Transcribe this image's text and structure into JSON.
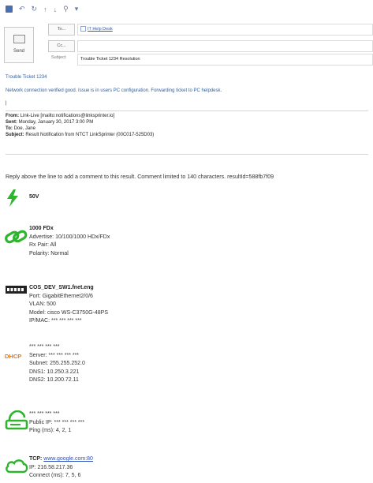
{
  "compose": {
    "send_label": "Send",
    "to_button": "To...",
    "cc_button": "Cc...",
    "subject_label": "Subject",
    "to_value": "IT Help Desk",
    "subject_value": "Trouble Ticket 1234 Resolution"
  },
  "body": {
    "ticket_title": "Trouble Ticket 1234",
    "note": "Network connection verified good. Issue is in users PC configuration. Forwarding ticket to PC helpdesk.",
    "cursor": "|",
    "from_label": "From:",
    "from_value": "Link-Live [mailto:notifications@linksprinter.io]",
    "sent_label": "Sent:",
    "sent_value": "Monday, January 30, 2017 3:00 PM",
    "to_label": "To:",
    "to_value": "Doe, Jane",
    "subject_label": "Subject:",
    "subject_value": "Result Notification from NTCT LinkSprinter (00C017-525D03)"
  },
  "reply_line": "Reply above the line to add a comment to this result. Comment limited to 140 characters. resultId=588fb7f09",
  "results": {
    "power": {
      "value": "50V"
    },
    "link": {
      "speed": "1000 FDx",
      "advertise": "Advertise: 10/100/1000 HDx/FDx",
      "rx_pair": "Rx Pair: All",
      "polarity": "Polarity: Normal"
    },
    "switch": {
      "name": "COS_DEV_SW1.fnet.eng",
      "port": "Port: GigabitEthernet2/0/6",
      "vlan": "VLAN: 500",
      "model": "Model: cisco WS-C3750G-48PS",
      "ipmac": "IP/MAC: *** *** *** ***"
    },
    "dhcp": {
      "label": "DHCP",
      "ip": "*** *** *** ***",
      "server": "Server: *** *** *** ***",
      "subnet": "Subnet: 255.255.252.0",
      "dns1": "DNS1: 10.250.3.221",
      "dns2": "DNS2: 10.200.72.11"
    },
    "gateway": {
      "ip": "*** *** *** ***",
      "public_ip": "Public IP: *** *** *** ***",
      "ping": "Ping (ms): 4, 2, 1"
    },
    "tcp": {
      "label": "TCP:",
      "url": "www.google.com:80",
      "ip": "IP: 216.58.217.36",
      "connect": "Connect (ms): 7, 5, 6"
    }
  },
  "colors": {
    "green": "#2db52d",
    "link": "#2d4fb8"
  }
}
